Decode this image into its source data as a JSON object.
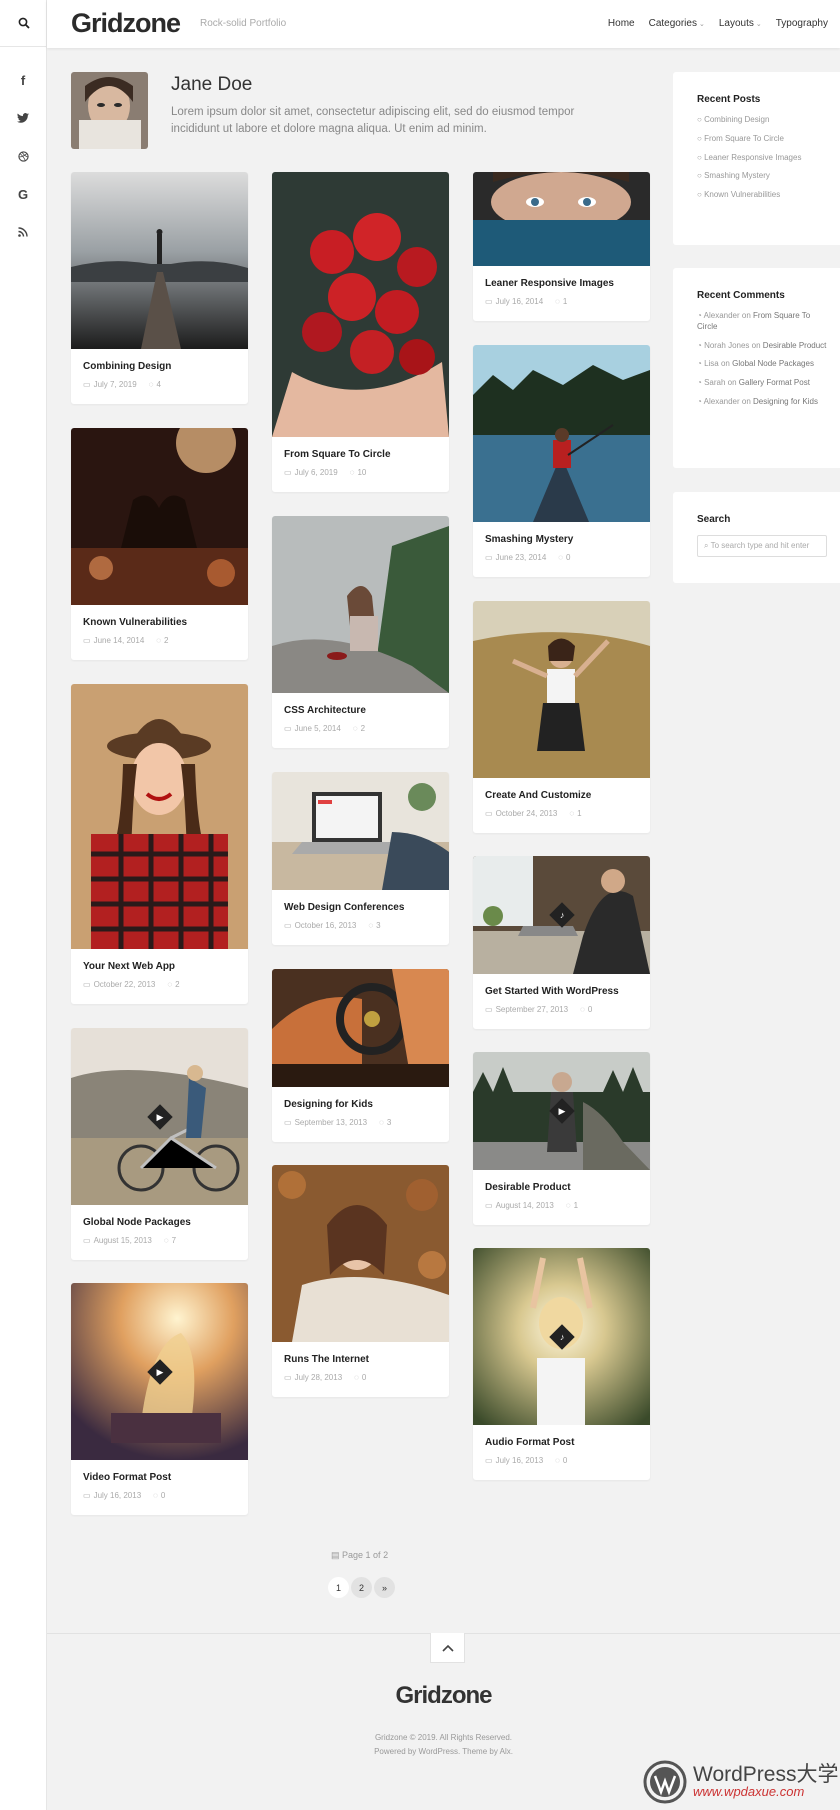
{
  "site": {
    "logo": "Gridzone",
    "tagline": "Rock-solid Portfolio"
  },
  "nav": {
    "home": "Home",
    "categories": "Categories",
    "layouts": "Layouts",
    "typography": "Typography"
  },
  "sidebar": {
    "social": [
      "f",
      "t",
      "d",
      "G",
      "rss"
    ]
  },
  "profile": {
    "name": "Jane Doe",
    "bio": "Lorem ipsum dolor sit amet, consectetur adipiscing elit, sed do eiusmod tempor incididunt ut labore et dolore magna aliqua. Ut enim ad minim."
  },
  "posts": [
    {
      "title": "Combining Design",
      "date": "July 7, 2019",
      "comments": "4"
    },
    {
      "title": "Known Vulnerabilities",
      "date": "June 14, 2014",
      "comments": "2"
    },
    {
      "title": "Your Next Web App",
      "date": "October 22, 2013",
      "comments": "2"
    },
    {
      "title": "Global Node Packages",
      "date": "August 15, 2013",
      "comments": "7"
    },
    {
      "title": "Video Format Post",
      "date": "July 16, 2013",
      "comments": "0"
    },
    {
      "title": "From Square To Circle",
      "date": "July 6, 2019",
      "comments": "10"
    },
    {
      "title": "CSS Architecture",
      "date": "June 5, 2014",
      "comments": "2"
    },
    {
      "title": "Web Design Conferences",
      "date": "October 16, 2013",
      "comments": "3"
    },
    {
      "title": "Designing for Kids",
      "date": "September 13, 2013",
      "comments": "3"
    },
    {
      "title": "Runs The Internet",
      "date": "July 28, 2013",
      "comments": "0"
    },
    {
      "title": "Leaner Responsive Images",
      "date": "July 16, 2014",
      "comments": "1"
    },
    {
      "title": "Smashing Mystery",
      "date": "June 23, 2014",
      "comments": "0"
    },
    {
      "title": "Create And Customize",
      "date": "October 24, 2013",
      "comments": "1"
    },
    {
      "title": "Get Started With WordPress",
      "date": "September 27, 2013",
      "comments": "0"
    },
    {
      "title": "Desirable Product",
      "date": "August 14, 2013",
      "comments": "1"
    },
    {
      "title": "Audio Format Post",
      "date": "July 16, 2013",
      "comments": "0"
    }
  ],
  "widgets": {
    "recent_posts": {
      "title": "Recent Posts",
      "items": [
        "Combining Design",
        "From Square To Circle",
        "Leaner Responsive Images",
        "Smashing Mystery",
        "Known Vulnerabilities"
      ]
    },
    "recent_comments": {
      "title": "Recent Comments",
      "items": [
        {
          "author": "Alexander",
          "on": "on",
          "post": "From Square To Circle"
        },
        {
          "author": "Norah Jones",
          "on": "on",
          "post": "Desirable Product"
        },
        {
          "author": "Lisa",
          "on": "on",
          "post": "Global Node Packages"
        },
        {
          "author": "Sarah",
          "on": "on",
          "post": "Gallery Format Post"
        },
        {
          "author": "Alexander",
          "on": "on",
          "post": "Designing for Kids"
        }
      ]
    },
    "search": {
      "title": "Search",
      "placeholder": "To search type and hit enter"
    }
  },
  "pagination": {
    "label": "Page 1 of 2",
    "pages": [
      "1",
      "2",
      "»"
    ]
  },
  "footer": {
    "logo": "Gridzone",
    "copyright": "Gridzone © 2019. All Rights Reserved.",
    "powered": "Powered by WordPress. Theme by Alx."
  },
  "watermark": {
    "brand": "WordPress大学",
    "url": "www.wpdaxue.com"
  },
  "colors": {
    "accent": "#222222",
    "bg": "#f2f2f2",
    "watermark_red": "#cc3333"
  }
}
